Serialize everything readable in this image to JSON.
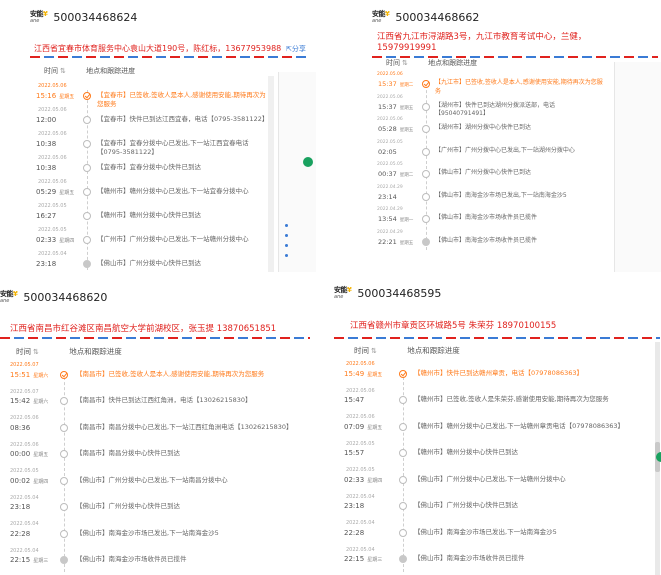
{
  "brand": {
    "logo_cn": "安能",
    "logo_mark": "¥",
    "logo_en": "ane"
  },
  "common": {
    "time_header": "时间",
    "sort_icon": "sort-icon",
    "track_header": "地点和跟踪进度",
    "share_label": "分享"
  },
  "panels": [
    {
      "tracking_no": "500034468624",
      "address": "江西省宜春市体育服务中心袁山大道190号，陈红标，13677953988",
      "rows": [
        {
          "date": "2022.05.06",
          "time": "15:16",
          "weekday": "星期五",
          "desc": "【宜春市】已签收,签收人是本人,感谢使用安能,期待再次为您服务"
        },
        {
          "date": "2022.05.06",
          "time": "12:00",
          "weekday": "",
          "desc": "【宜春市】快件已到达江西宜春，电话【0795-3581122】"
        },
        {
          "date": "2022.05.06",
          "time": "10:38",
          "weekday": "",
          "desc": "【宜春市】宜春分拨中心已发出,下一站江西宜春电话【0795-3581122】"
        },
        {
          "date": "2022.05.06",
          "time": "10:38",
          "weekday": "",
          "desc": "【宜春市】宜春分拨中心快件已到达"
        },
        {
          "date": "2022.05.06",
          "time": "05:29",
          "weekday": "星期五",
          "desc": "【赣州市】赣州分拨中心已发出,下一站宜春分拨中心"
        },
        {
          "date": "2022.05.05",
          "time": "16:27",
          "weekday": "",
          "desc": "【赣州市】赣州分拨中心快件已到达"
        },
        {
          "date": "2022.05.05",
          "time": "02:33",
          "weekday": "星期四",
          "desc": "【广州市】广州分拨中心已发出,下一站赣州分拨中心"
        },
        {
          "date": "2022.05.04",
          "time": "23:18",
          "weekday": "",
          "desc": "【佛山市】广州分拨中心快件已到达"
        }
      ]
    },
    {
      "tracking_no": "500034468662",
      "address": "江西省九江市浔湖路3号，九江市教育考试中心，兰健，15979919991",
      "rows": [
        {
          "date": "2022.05.06",
          "time": "15:37",
          "weekday": "星期二",
          "desc": "【九江市】已签收,签收人是本人,感谢使用安能,期待再次为您服务"
        },
        {
          "date": "2022.05.06",
          "time": "15:37",
          "weekday": "星期五",
          "desc": "【湖州市】快件已到达湖州分拨派送部，电话【95040791491】"
        },
        {
          "date": "2022.05.06",
          "time": "05:28",
          "weekday": "星期五",
          "desc": "【湖州市】湖州分拨中心快件已到达"
        },
        {
          "date": "2022.05.05",
          "time": "02:05",
          "weekday": "",
          "desc": "【广州市】广州分拨中心已发出,下一站湖州分拨中心"
        },
        {
          "date": "2022.05.05",
          "time": "00:37",
          "weekday": "星期二",
          "desc": "【佛山市】广州分拨中心快件已到达"
        },
        {
          "date": "2022.04.29",
          "time": "23:14",
          "weekday": "",
          "desc": "【佛山市】南海金沙市场已发出,下一站南海金沙5"
        },
        {
          "date": "2022.04.29",
          "time": "13:54",
          "weekday": "星期一",
          "desc": "【佛山市】南海金沙市场收件员已揽件"
        },
        {
          "date": "2022.04.29",
          "time": "22:21",
          "weekday": "星期五",
          "desc": "【佛山市】南海金沙市场收件员已揽件"
        }
      ]
    },
    {
      "tracking_no": "500034468620",
      "address": "江西省南昌市红谷滩区南昌航空大学前湖校区，张玉提 13870651851",
      "rows": [
        {
          "date": "2022.05.07",
          "time": "15:51",
          "weekday": "星期六",
          "desc": "【南昌市】已签收,签收人是本人,感谢使用安能,期待再次为您服务"
        },
        {
          "date": "2022.05.07",
          "time": "15:42",
          "weekday": "星期六",
          "desc": "【南昌市】快件已到达江西红角洲，电话【13026215830】"
        },
        {
          "date": "2022.05.06",
          "time": "08:36",
          "weekday": "",
          "desc": "【南昌市】南昌分拨中心已发出,下一站江西红角洲电话【13026215830】"
        },
        {
          "date": "2022.05.06",
          "time": "00:00",
          "weekday": "星期五",
          "desc": "【南昌市】南昌分拨中心快件已到达"
        },
        {
          "date": "2022.05.05",
          "time": "00:02",
          "weekday": "星期四",
          "desc": "【佛山市】广州分拨中心已发出,下一站南昌分拨中心"
        },
        {
          "date": "2022.05.04",
          "time": "23:18",
          "weekday": "",
          "desc": "【佛山市】广州分拨中心快件已到达"
        },
        {
          "date": "2022.05.04",
          "time": "22:28",
          "weekday": "",
          "desc": "【佛山市】南海金沙市场已发出,下一站南海金沙5"
        },
        {
          "date": "2022.05.04",
          "time": "22:15",
          "weekday": "星期三",
          "desc": "【佛山市】南海金沙市场收件员已揽件"
        }
      ]
    },
    {
      "tracking_no": "500034468595",
      "address": "江西省赣州市章贡区环城路5号 朱荣芬 18970100155",
      "rows": [
        {
          "date": "2022.05.06",
          "time": "15:49",
          "weekday": "星期五",
          "desc": "【赣州市】快件已到达赣州章贡，电话【07978086363】"
        },
        {
          "date": "2022.05.06",
          "time": "15:47",
          "weekday": "",
          "desc": "【赣州市】已签收,签收人是朱荣芬,感谢使用安能,期待再次为您服务"
        },
        {
          "date": "2022.05.06",
          "time": "07:09",
          "weekday": "星期五",
          "desc": "【赣州市】赣州分拨中心已发出,下一站赣州章贡电话【07978086363】"
        },
        {
          "date": "2022.05.05",
          "time": "15:57",
          "weekday": "",
          "desc": "【赣州市】赣州分拨中心快件已到达"
        },
        {
          "date": "2022.05.05",
          "time": "02:33",
          "weekday": "星期四",
          "desc": "【佛山市】广州分拨中心已发出,下一站赣州分拨中心"
        },
        {
          "date": "2022.05.04",
          "time": "23:18",
          "weekday": "",
          "desc": "【佛山市】广州分拨中心快件已到达"
        },
        {
          "date": "2022.05.04",
          "time": "22:28",
          "weekday": "",
          "desc": "【佛山市】南海金沙市场已发出,下一站南海金沙5"
        },
        {
          "date": "2022.05.04",
          "time": "22:15",
          "weekday": "星期三",
          "desc": "【佛山市】南海金沙市场收件员已揽件"
        }
      ]
    }
  ]
}
